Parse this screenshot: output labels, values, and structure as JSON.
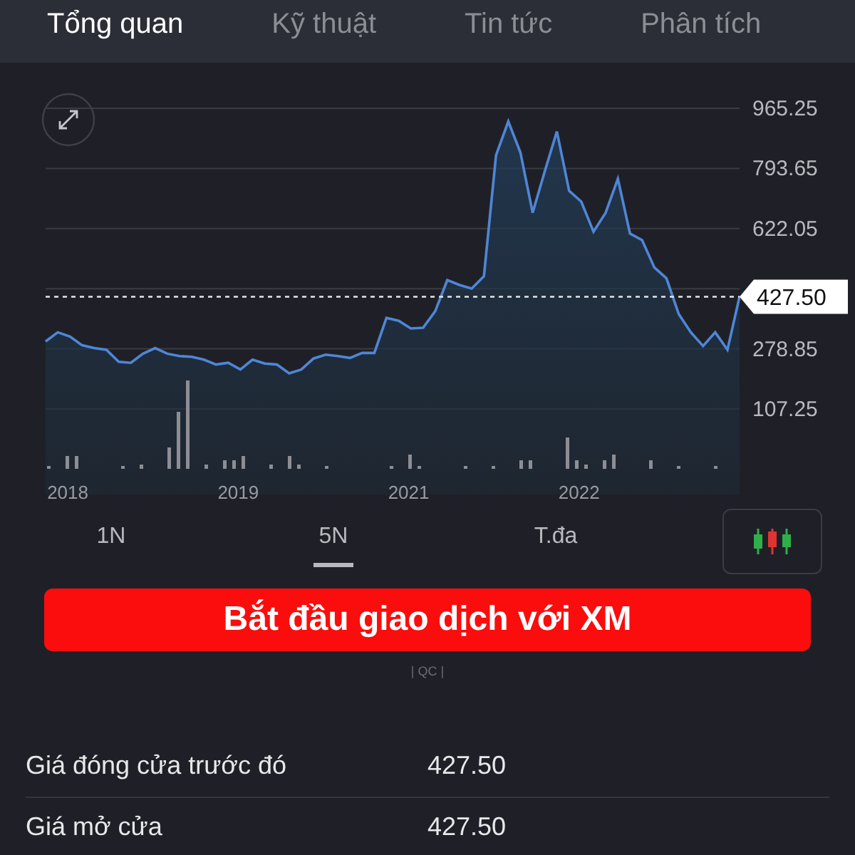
{
  "tabs": [
    {
      "label": "Tổng quan",
      "selected": true
    },
    {
      "label": "Kỹ thuật",
      "selected": false
    },
    {
      "label": "Tin tức",
      "selected": false
    },
    {
      "label": "Phân tích",
      "selected": false
    }
  ],
  "chart": {
    "chart_data": {
      "type": "area",
      "categories": [
        null,
        null,
        "2018",
        null,
        null,
        null,
        null,
        null,
        null,
        null,
        null,
        null,
        null,
        null,
        null,
        null,
        "2019",
        null,
        null,
        null,
        null,
        null,
        null,
        null,
        null,
        null,
        null,
        null,
        null,
        null,
        "2021",
        null,
        null,
        null,
        null,
        null,
        null,
        null,
        null,
        null,
        null,
        null,
        null,
        null,
        "2022",
        null,
        null,
        null,
        null,
        null,
        null,
        null,
        null,
        null,
        null,
        null,
        null,
        null
      ],
      "series": [
        {
          "color": "#4f86d6",
          "values": [
            300,
            326,
            314,
            289,
            281,
            276,
            242,
            239,
            265,
            281,
            265,
            258,
            256,
            248,
            234,
            239,
            220,
            248,
            237,
            234,
            209,
            220,
            251,
            262,
            258,
            253,
            267,
            267,
            367,
            359,
            337,
            339,
            386,
            475,
            461,
            451,
            486,
            831,
            928,
            839,
            667,
            785,
            899,
            730,
            699,
            613,
            667,
            764,
            608,
            589,
            511,
            480,
            378,
            326,
            287,
            326,
            276,
            428
          ]
        }
      ],
      "ylim": [
        107.25,
        965.25
      ],
      "yticks": [
        {
          "value": 965.25,
          "label": "965.25"
        },
        {
          "value": 793.65,
          "label": "793.65"
        },
        {
          "value": 622.05,
          "label": "622.05"
        },
        {
          "value": 278.85,
          "label": "278.85"
        },
        {
          "value": 107.25,
          "label": "107.25"
        }
      ],
      "grid": true,
      "ref_lines": [
        {
          "axis": "y",
          "value": 427.5,
          "label": "427.50"
        }
      ]
    }
  },
  "ranges": [
    {
      "label": "1N",
      "selected": false
    },
    {
      "label": "5N",
      "selected": true
    },
    {
      "label": "T.đa",
      "selected": false
    }
  ],
  "cta": {
    "label": "Bắt đầu giao dịch với XM",
    "ad_label": "| QC |"
  },
  "stats": [
    {
      "label": "Giá đóng cửa trước đó",
      "value": "427.50"
    },
    {
      "label": "Giá mở cửa",
      "value": "427.50"
    }
  ]
}
